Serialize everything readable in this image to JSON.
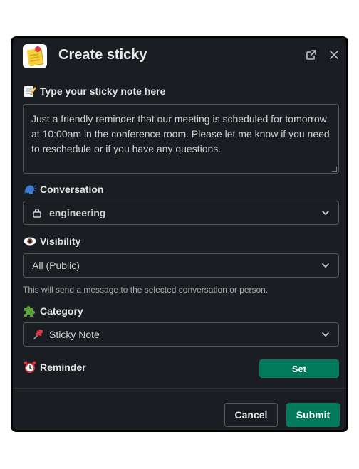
{
  "dialog": {
    "title": "Create sticky",
    "app_icon": "sticky-note-icon",
    "popout_icon": "external-link-icon",
    "close_icon": "close-icon"
  },
  "note_field": {
    "label": "Type your sticky note here",
    "icon": "memo-icon",
    "value": "Just a friendly reminder that our meeting is scheduled for tomorrow at 10:00am in the conference room. Please let me know if you need to reschedule or if you have any questions."
  },
  "conversation": {
    "label": "Conversation",
    "icon": "speaking-head-icon",
    "value": "engineering",
    "value_icon": "lock-icon"
  },
  "visibility": {
    "label": "Visibility",
    "icon": "eye-icon",
    "value": "All (Public)",
    "hint": "This will send a message to the selected conversation or person."
  },
  "category": {
    "label": "Category",
    "icon": "puzzle-piece-icon",
    "value": "Sticky Note",
    "value_icon": "pushpin-icon"
  },
  "reminder": {
    "label": "Reminder",
    "icon": "alarm-clock-icon",
    "button": "Set"
  },
  "footer": {
    "cancel": "Cancel",
    "submit": "Submit"
  },
  "colors": {
    "background": "#1a1d21",
    "accent": "#007a5a",
    "border": "#565856",
    "text": "#d1d2d3"
  }
}
